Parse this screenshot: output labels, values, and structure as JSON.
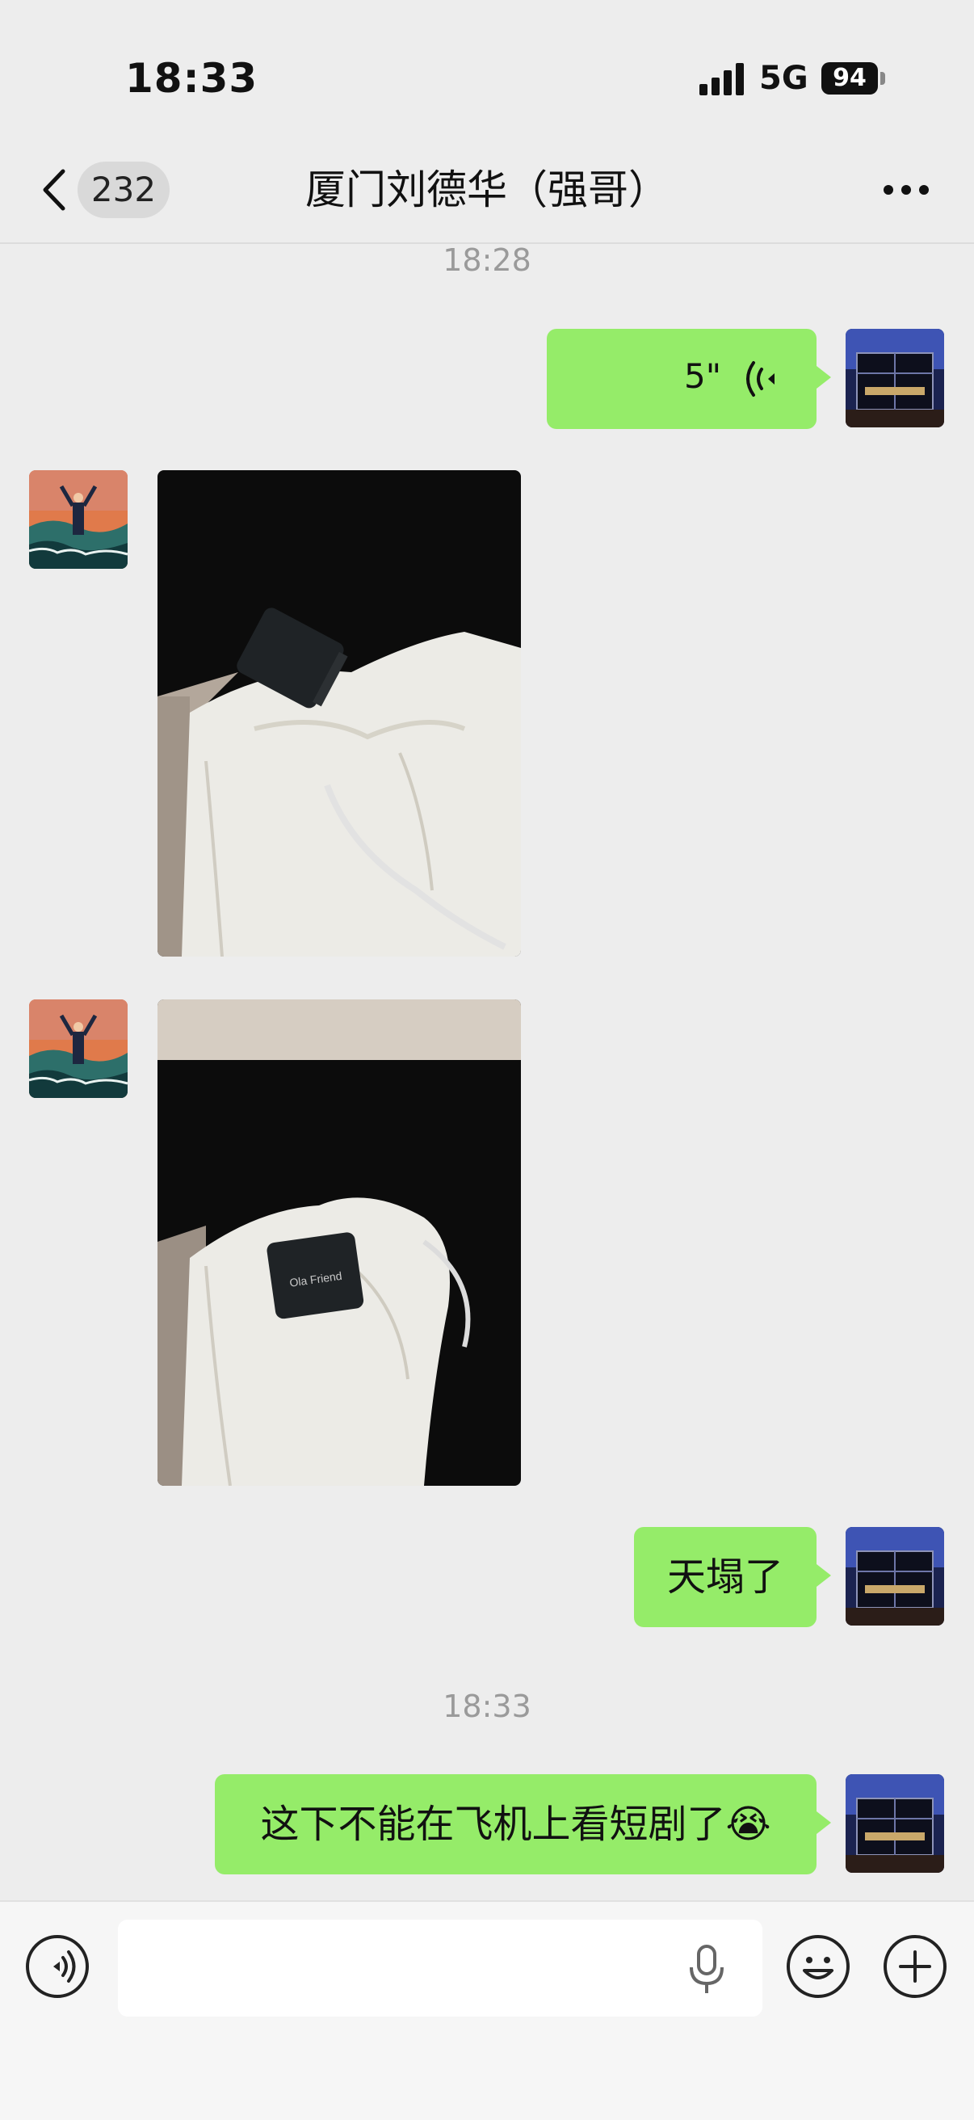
{
  "status_bar": {
    "time": "18:33",
    "network": "5G",
    "battery": "94"
  },
  "header": {
    "unread_count": "232",
    "title": "厦门刘德华（强哥）",
    "icons": [
      "chevron-left-icon",
      "more-icon"
    ]
  },
  "messages": [
    {
      "type": "timestamp",
      "text": "18:28"
    },
    {
      "type": "voice",
      "direction": "outgoing",
      "duration": "5\""
    },
    {
      "type": "image",
      "direction": "incoming"
    },
    {
      "type": "image",
      "direction": "incoming"
    },
    {
      "type": "text",
      "direction": "outgoing",
      "text": "天塌了"
    },
    {
      "type": "timestamp",
      "text": "18:33"
    },
    {
      "type": "text",
      "direction": "outgoing",
      "text": "这下不能在飞机上看短剧了😭"
    }
  ],
  "photo_labels": {
    "photo_2_device_text": "Ola Friend"
  },
  "input_bar": {
    "placeholder": "",
    "icons": [
      "voice-toggle-icon",
      "mic-icon",
      "emoji-icon",
      "plus-icon"
    ]
  },
  "colors": {
    "background": "#ededed",
    "outgoing_bubble": "#95ec69",
    "timestamp": "#9a9a9a"
  }
}
